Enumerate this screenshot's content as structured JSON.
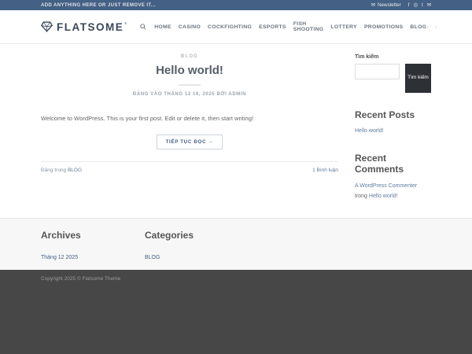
{
  "topbar": {
    "left_text": "ADD ANYTHING HERE OR JUST REMOVE IT...",
    "newsletter_icon_glyph": "✉",
    "newsletter_label": "Newsletter",
    "social": [
      {
        "name": "facebook",
        "glyph": "f"
      },
      {
        "name": "instagram",
        "glyph": "◎"
      },
      {
        "name": "twitter",
        "glyph": "t"
      },
      {
        "name": "email",
        "glyph": "✉"
      }
    ]
  },
  "header": {
    "logo_text": "FLATSOME",
    "logo_reg_mark": "®",
    "nav_items": [
      "HOME",
      "CASINO",
      "COCKFIGHTING",
      "ESPORTS",
      "FISH SHOOTING",
      "LOTTERY",
      "PROMOTIONS",
      "BLOG"
    ],
    "chevron_prev": "‹",
    "chevron_next": "›"
  },
  "post": {
    "category": "BLOG",
    "title": "Hello world!",
    "meta": "ĐĂNG VÀO THÁNG 12 16, 2025 BỞI ADMIN",
    "excerpt": "Welcome to WordPress. This is your first post. Edit or delete it, then start writing!",
    "read_more": "TIẾP TỤC ĐỌC →",
    "posted_in_prefix": "Đăng trong ",
    "posted_in_category": "BLOG",
    "comments_link": "1 Bình luận"
  },
  "sidebar": {
    "search_label": "Tìm kiếm",
    "search_input_value": "",
    "search_button": "Tìm kiếm",
    "recent_posts_title": "Recent Posts",
    "recent_posts": [
      "Hello world!"
    ],
    "recent_comments_title": "Recent Comments",
    "comment_author": "A WordPress Commenter",
    "comment_connector": " trong ",
    "comment_post": "Hello world!"
  },
  "footer": {
    "archives_title": "Archives",
    "archives_links": [
      "Tháng 12 2025"
    ],
    "categories_title": "Categories",
    "categories_links": [
      "BLOG"
    ],
    "copyright": "Copyright 2025 © Flatsome Theme"
  },
  "colors": {
    "topbar_bg": "#446084",
    "accent": "#446084",
    "sidebar_link": "#5e7c9e",
    "search_button_bg": "#2d3136",
    "dark_footer_bg": "#474747"
  }
}
